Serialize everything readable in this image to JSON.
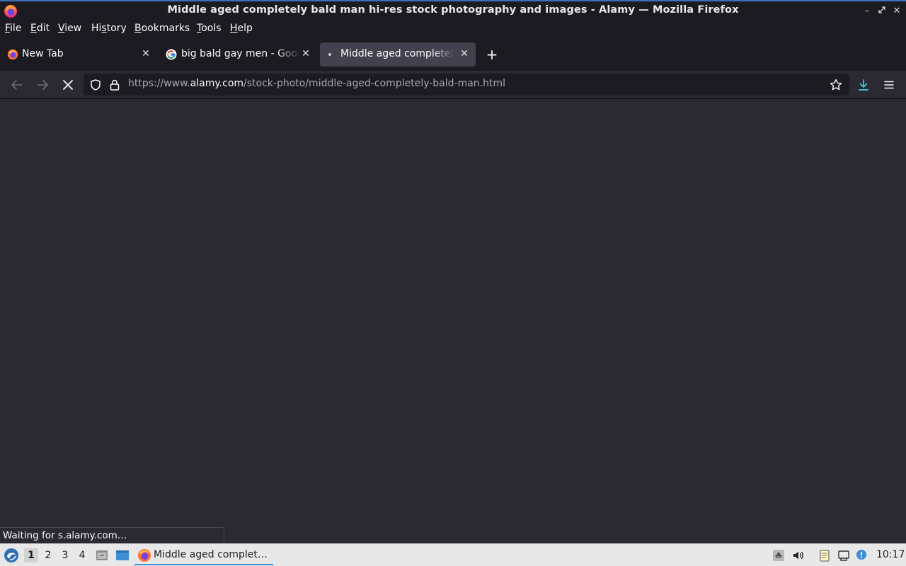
{
  "window": {
    "title": "Middle aged completely bald man hi-res stock photography and images - Alamy — Mozilla Firefox"
  },
  "menu": {
    "items": [
      {
        "label": "File",
        "accel": "F"
      },
      {
        "label": "Edit",
        "accel": "E"
      },
      {
        "label": "View",
        "accel": "V"
      },
      {
        "label": "History",
        "accel": "s"
      },
      {
        "label": "Bookmarks",
        "accel": "B"
      },
      {
        "label": "Tools",
        "accel": "T"
      },
      {
        "label": "Help",
        "accel": "H"
      }
    ]
  },
  "tabs": [
    {
      "label": "New Tab",
      "icon": "firefox-icon",
      "active": false
    },
    {
      "label": "big bald gay men - Google Search",
      "icon": "google-icon",
      "active": false
    },
    {
      "label": "Middle aged completely bald man hi-res stock photography and images - Alamy",
      "icon": "loading-dot-icon",
      "active": true
    }
  ],
  "navbar": {
    "url_prefix": "https://www.",
    "url_domain": "alamy.com",
    "url_path": "/stock-photo/middle-aged-completely-bald-man.html"
  },
  "status": {
    "text": "Waiting for s.alamy.com…"
  },
  "taskbar": {
    "workspaces": [
      "1",
      "2",
      "3",
      "4"
    ],
    "active_workspace": "1",
    "task_label": "Middle aged complet…",
    "clock": "10:17"
  },
  "colors": {
    "accent": "#3d8fd6",
    "chrome_dark": "#1c1b22",
    "content_bg": "#2b2a33"
  }
}
